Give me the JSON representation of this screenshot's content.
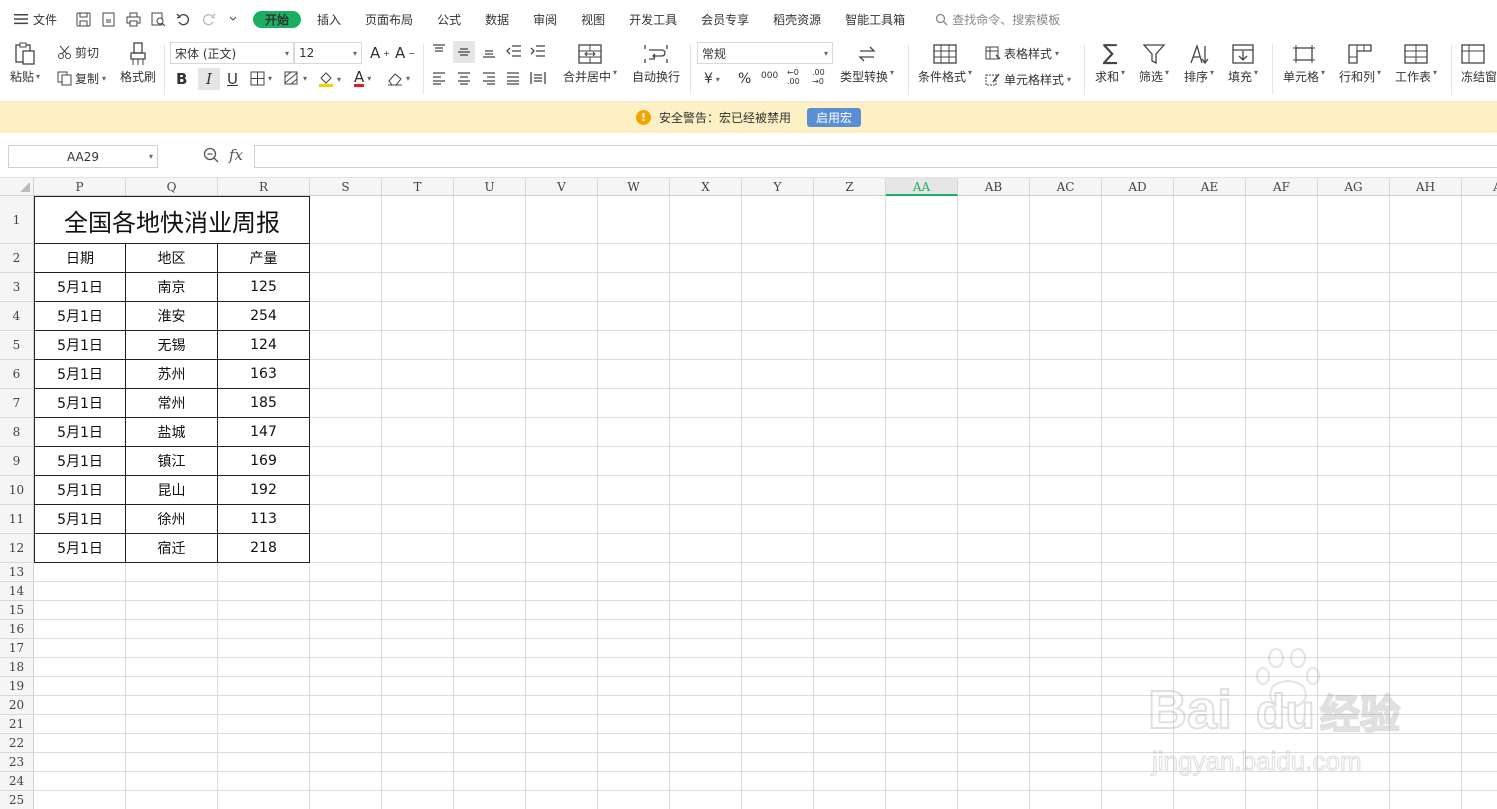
{
  "menu": {
    "file_label": "文件",
    "tabs": [
      "开始",
      "插入",
      "页面布局",
      "公式",
      "数据",
      "审阅",
      "视图",
      "开发工具",
      "会员专享",
      "稻壳资源",
      "智能工具箱"
    ],
    "active_tab": "开始",
    "search_placeholder": "查找命令、搜索模板"
  },
  "ribbon": {
    "paste": "粘贴",
    "cut": "剪切",
    "copy": "复制",
    "format_painter": "格式刷",
    "font_name": "宋体 (正文)",
    "font_size": "12",
    "merge_center": "合并居中",
    "wrap_text": "自动换行",
    "number_format": "常规",
    "type_convert": "类型转换",
    "conditional_format": "条件格式",
    "table_style": "表格样式",
    "cell_style": "单元格样式",
    "sum": "求和",
    "filter": "筛选",
    "sort": "排序",
    "fill": "填充",
    "cell": "单元格",
    "row_col": "行和列",
    "worksheet": "工作表",
    "freeze": "冻结窗",
    "bold": "B",
    "italic": "I",
    "underline": "U",
    "currency": "¥",
    "percent": "%",
    "thousands": "000",
    "font_color_a": "A",
    "dec_inc": "←0 .00",
    "dec_dec": ".00 →0"
  },
  "warning": {
    "text": "安全警告：宏已经被禁用",
    "button": "启用宏"
  },
  "formula_bar": {
    "name_box": "AA29",
    "fx": "fx",
    "formula": ""
  },
  "columns": [
    "P",
    "Q",
    "R",
    "S",
    "T",
    "U",
    "V",
    "W",
    "X",
    "Y",
    "Z",
    "AA",
    "AB",
    "AC",
    "AD",
    "AE",
    "AF",
    "AG",
    "AH",
    "A"
  ],
  "selected_column": "AA",
  "rows": [
    "1",
    "2",
    "3",
    "4",
    "5",
    "6",
    "7",
    "8",
    "9",
    "10",
    "11",
    "12",
    "13",
    "14",
    "15",
    "16",
    "17",
    "18",
    "19",
    "20",
    "21",
    "22",
    "23",
    "24",
    "25"
  ],
  "sheet": {
    "title": "全国各地快消业周报",
    "headers": [
      "日期",
      "地区",
      "产量"
    ],
    "data": [
      [
        "5月1日",
        "南京",
        "125"
      ],
      [
        "5月1日",
        "淮安",
        "254"
      ],
      [
        "5月1日",
        "无锡",
        "124"
      ],
      [
        "5月1日",
        "苏州",
        "163"
      ],
      [
        "5月1日",
        "常州",
        "185"
      ],
      [
        "5月1日",
        "盐城",
        "147"
      ],
      [
        "5月1日",
        "镇江",
        "169"
      ],
      [
        "5月1日",
        "昆山",
        "192"
      ],
      [
        "5月1日",
        "徐州",
        "113"
      ],
      [
        "5月1日",
        "宿迁",
        "218"
      ]
    ]
  },
  "watermark": {
    "brand": "Bai",
    "brand2": "du",
    "suffix": "经验",
    "url": "jingyan.baidu.com"
  },
  "colors": {
    "accent": "#1bb061",
    "warning_bg": "#fdf0c4",
    "macro_btn": "#5b8fd3"
  }
}
